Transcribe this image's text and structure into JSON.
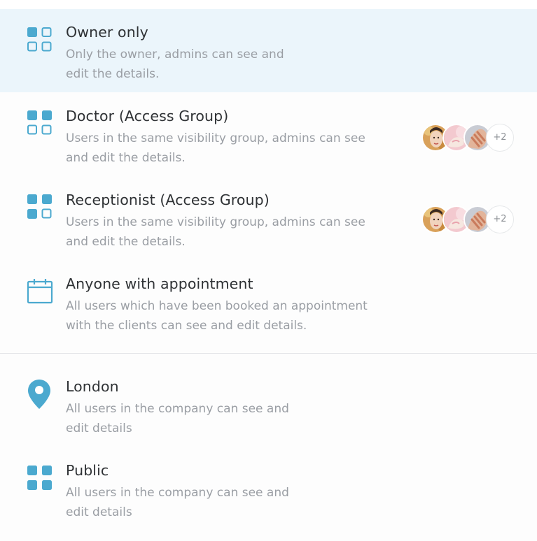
{
  "options": [
    {
      "title": "Owner only",
      "description": "Only the owner, admins can see and\nedit the details.",
      "icon": "grid-outline-icon",
      "selected": true
    },
    {
      "title": "Doctor (Access Group)",
      "description": "Users in the same visibility group, admins can see\nand edit the details.",
      "icon": "grid-half-filled-icon",
      "members_more": "+2"
    },
    {
      "title": "Receptionist (Access Group)",
      "description": "Users in the same visibility group, admins can see\nand edit the details.",
      "icon": "grid-mostly-filled-icon",
      "members_more": "+2"
    },
    {
      "title": "Anyone with appointment",
      "description": "All users which have been booked an appointment\nwith the clients can see and edit details.",
      "icon": "calendar-icon"
    },
    {
      "title": "London",
      "description": "All users in the company can see and\nedit details",
      "icon": "location-pin-icon"
    },
    {
      "title": "Public",
      "description": "All users in the company can see and\nedit details",
      "icon": "grid-filled-icon"
    }
  ],
  "colors": {
    "accent": "#4ba9cf",
    "selected_bg": "#ebf5fb",
    "title_text": "#2f3235",
    "description_text": "#9a9ea4",
    "divider": "#e2e4e7"
  }
}
